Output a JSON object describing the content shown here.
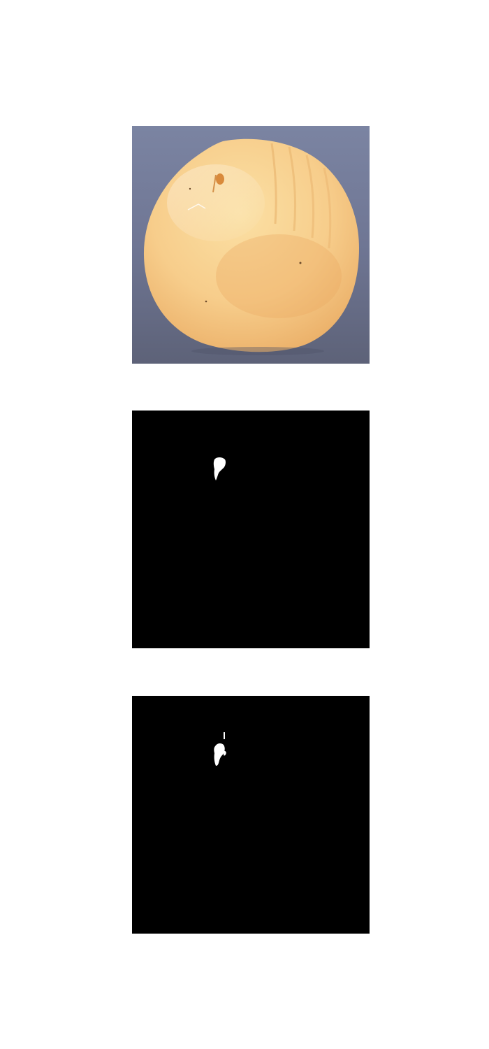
{
  "figure": {
    "panels": [
      {
        "kind": "photo",
        "subject": "seed",
        "background_color": "#6d7592",
        "subject_color": "#f5c98a"
      },
      {
        "kind": "binary-mask",
        "background_color": "#000000",
        "mask_color": "#ffffff"
      },
      {
        "kind": "binary-mask",
        "background_color": "#000000",
        "mask_color": "#ffffff"
      }
    ]
  }
}
